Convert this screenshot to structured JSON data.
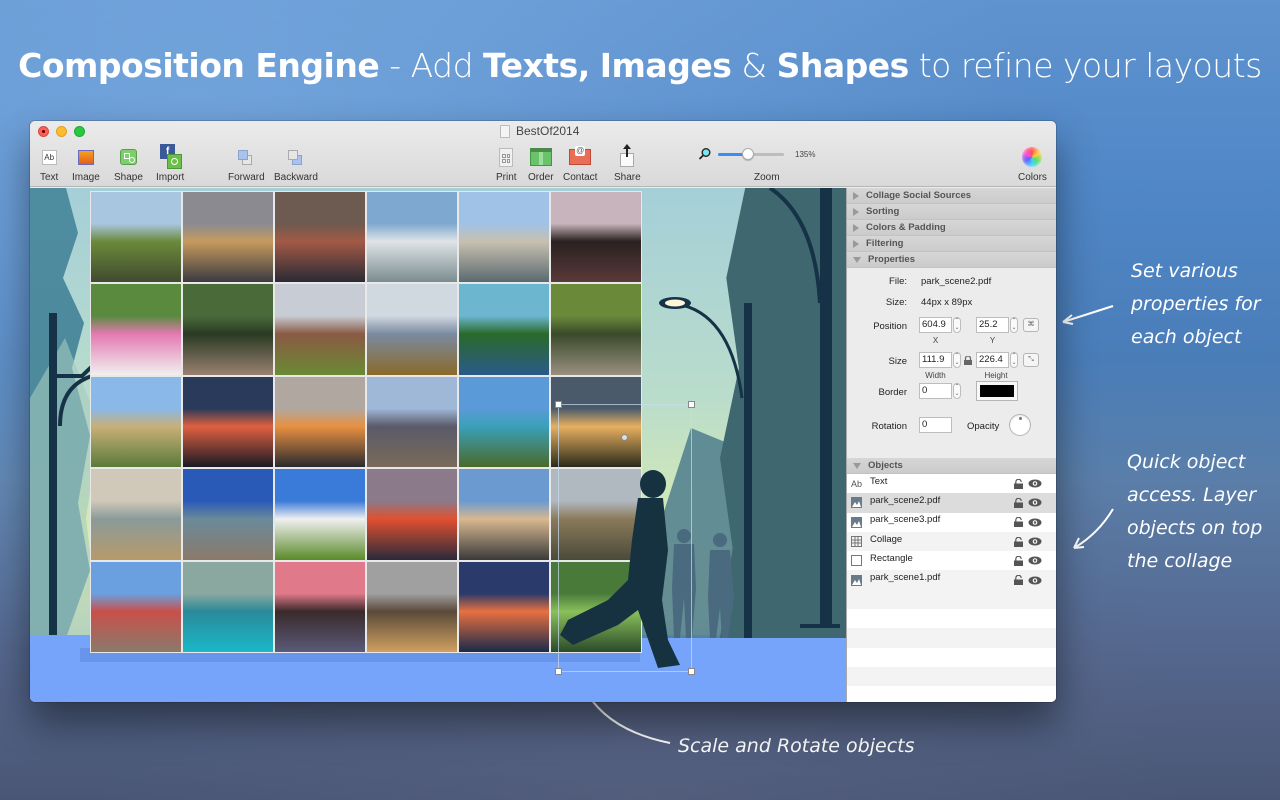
{
  "headline": {
    "part1_bold": "Composition Engine",
    "part2": " - Add ",
    "part3_bold": "Texts,",
    "part4": " ",
    "part5_bold": "Images",
    "part6": " & ",
    "part7_bold": "Shapes",
    "part8": " to refine your layouts"
  },
  "annotations": {
    "properties_note": [
      "Set various",
      "properties for",
      "each object"
    ],
    "objects_note": [
      "Quick object",
      "access. Layer",
      "objects on top",
      "the collage"
    ],
    "scale_note": "Scale and Rotate objects"
  },
  "window": {
    "title": "BestOf2014",
    "toolbar": {
      "text": "Text",
      "image": "Image",
      "shape": "Shape",
      "import": "Import",
      "forward": "Forward",
      "backward": "Backward",
      "print": "Print",
      "order": "Order",
      "contact": "Contact",
      "share": "Share",
      "zoom_label": "Zoom",
      "zoom_value": "135%",
      "zoom_fraction": 0.45,
      "colors": "Colors"
    }
  },
  "inspector": {
    "sections": [
      {
        "label": "Collage Social Sources",
        "open": false
      },
      {
        "label": "Sorting",
        "open": false
      },
      {
        "label": "Colors & Padding",
        "open": false
      },
      {
        "label": "Filtering",
        "open": false
      },
      {
        "label": "Properties",
        "open": true
      }
    ],
    "properties": {
      "file_label": "File:",
      "file_value": "park_scene2.pdf",
      "size_label": "Size:",
      "size_value": "44px x 89px",
      "position_label": "Position",
      "position_x": "604.9",
      "position_y": "25.2",
      "x_label": "X",
      "y_label": "Y",
      "dimensions_label": "Size",
      "width_value": "111.9",
      "height_value": "226.4",
      "width_label": "Width",
      "height_label": "Height",
      "border_label": "Border",
      "border_value": "0",
      "border_color": "#000000",
      "rotation_label": "Rotation",
      "rotation_value": "0",
      "opacity_label": "Opacity"
    },
    "objects_header": "Objects",
    "objects": [
      {
        "name": "Text",
        "icon": "text-icon",
        "selected": false
      },
      {
        "name": "park_scene2.pdf",
        "icon": "image-icon",
        "selected": true
      },
      {
        "name": "park_scene3.pdf",
        "icon": "image-icon",
        "selected": false
      },
      {
        "name": "Collage",
        "icon": "grid-icon",
        "selected": false
      },
      {
        "name": "Rectangle",
        "icon": "rectangle-icon",
        "selected": false
      },
      {
        "name": "park_scene1.pdf",
        "icon": "image-icon",
        "selected": false
      }
    ]
  },
  "collage": {
    "tiles": [
      {
        "subject": "river with trees",
        "colors": [
          "#a9c6e0",
          "#6b8a3a",
          "#404a30"
        ]
      },
      {
        "subject": "city skyline at dusk",
        "colors": [
          "#8a8a90",
          "#c79a5e",
          "#3a3a40"
        ]
      },
      {
        "subject": "narrow old street",
        "colors": [
          "#6d5a50",
          "#a35a45",
          "#2a2a35"
        ]
      },
      {
        "subject": "beach with clouds",
        "colors": [
          "#7ea8d0",
          "#dfe4e6",
          "#7a8c8f"
        ]
      },
      {
        "subject": "bridge over river",
        "colors": [
          "#9fc2e6",
          "#c8c0b0",
          "#5a6a70"
        ]
      },
      {
        "subject": "lake at dusk",
        "colors": [
          "#c8b4bc",
          "#2a2020",
          "#5a3a3a"
        ]
      },
      {
        "subject": "color run runner",
        "colors": [
          "#5a8a3e",
          "#e47ab2",
          "#f0f0f0"
        ]
      },
      {
        "subject": "forest path",
        "colors": [
          "#4a6a3a",
          "#2a3a24",
          "#9a8070"
        ]
      },
      {
        "subject": "brick building lawn",
        "colors": [
          "#c8ccd4",
          "#8a5a44",
          "#6a8a34"
        ]
      },
      {
        "subject": "hills through trees",
        "colors": [
          "#d0d8e0",
          "#7a8aa0",
          "#8a6a2a"
        ]
      },
      {
        "subject": "island and sea",
        "colors": [
          "#6cb6d0",
          "#2a6a2a",
          "#2a5a8a"
        ]
      },
      {
        "subject": "pond in forest",
        "colors": [
          "#6a8a3a",
          "#3a4a2a",
          "#9a9080"
        ]
      },
      {
        "subject": "lighthouse",
        "colors": [
          "#8ab8e8",
          "#c8b078",
          "#5a7a3a"
        ]
      },
      {
        "subject": "sunset with benches",
        "colors": [
          "#2a3a5a",
          "#e06040",
          "#1a1a24"
        ]
      },
      {
        "subject": "harbor sunset",
        "colors": [
          "#b0a8a0",
          "#e89040",
          "#2a2a30"
        ]
      },
      {
        "subject": "wooden pier",
        "colors": [
          "#a0b8d8",
          "#5a5a6a",
          "#7a6a5a"
        ]
      },
      {
        "subject": "crater lake",
        "colors": [
          "#5a9ad8",
          "#3aa0b8",
          "#4a6a2a"
        ]
      },
      {
        "subject": "sunset field",
        "colors": [
          "#4a5a6a",
          "#e8b060",
          "#2a2a1a"
        ]
      },
      {
        "subject": "misty beach",
        "colors": [
          "#d0c8b8",
          "#8a9a9a",
          "#b89a6a"
        ]
      },
      {
        "subject": "palm beach",
        "colors": [
          "#2a5ab8",
          "#6a8a9a",
          "#8a7a6a"
        ]
      },
      {
        "subject": "marsh and clouds",
        "colors": [
          "#3a7ad8",
          "#f0f0f0",
          "#5a8a2a"
        ]
      },
      {
        "subject": "hiker with backpack",
        "colors": [
          "#8a7a8a",
          "#e05030",
          "#2a2a3a"
        ]
      },
      {
        "subject": "city skyline",
        "colors": [
          "#6a9ad0",
          "#d8b890",
          "#3a3a3a"
        ]
      },
      {
        "subject": "river town",
        "colors": [
          "#b0b8c0",
          "#8a7a5a",
          "#4a4a3a"
        ]
      },
      {
        "subject": "colorful houses",
        "colors": [
          "#6aa0e0",
          "#c8504a",
          "#8a7a6a"
        ]
      },
      {
        "subject": "palace teal filter",
        "colors": [
          "#8aa8a0",
          "#2a8a9a",
          "#1ab8c8"
        ]
      },
      {
        "subject": "palm at sunset",
        "colors": [
          "#e07a8a",
          "#3a2a2a",
          "#5a5a7a"
        ]
      },
      {
        "subject": "shoreline sunset",
        "colors": [
          "#a0a0a0",
          "#5a4a3a",
          "#d0a060"
        ]
      },
      {
        "subject": "ocean dusk",
        "colors": [
          "#2a3a6a",
          "#e87040",
          "#1a2a4a"
        ]
      },
      {
        "subject": "park trees",
        "colors": [
          "#4a7a3a",
          "#8ac05a",
          "#2a4a2a"
        ]
      }
    ]
  }
}
